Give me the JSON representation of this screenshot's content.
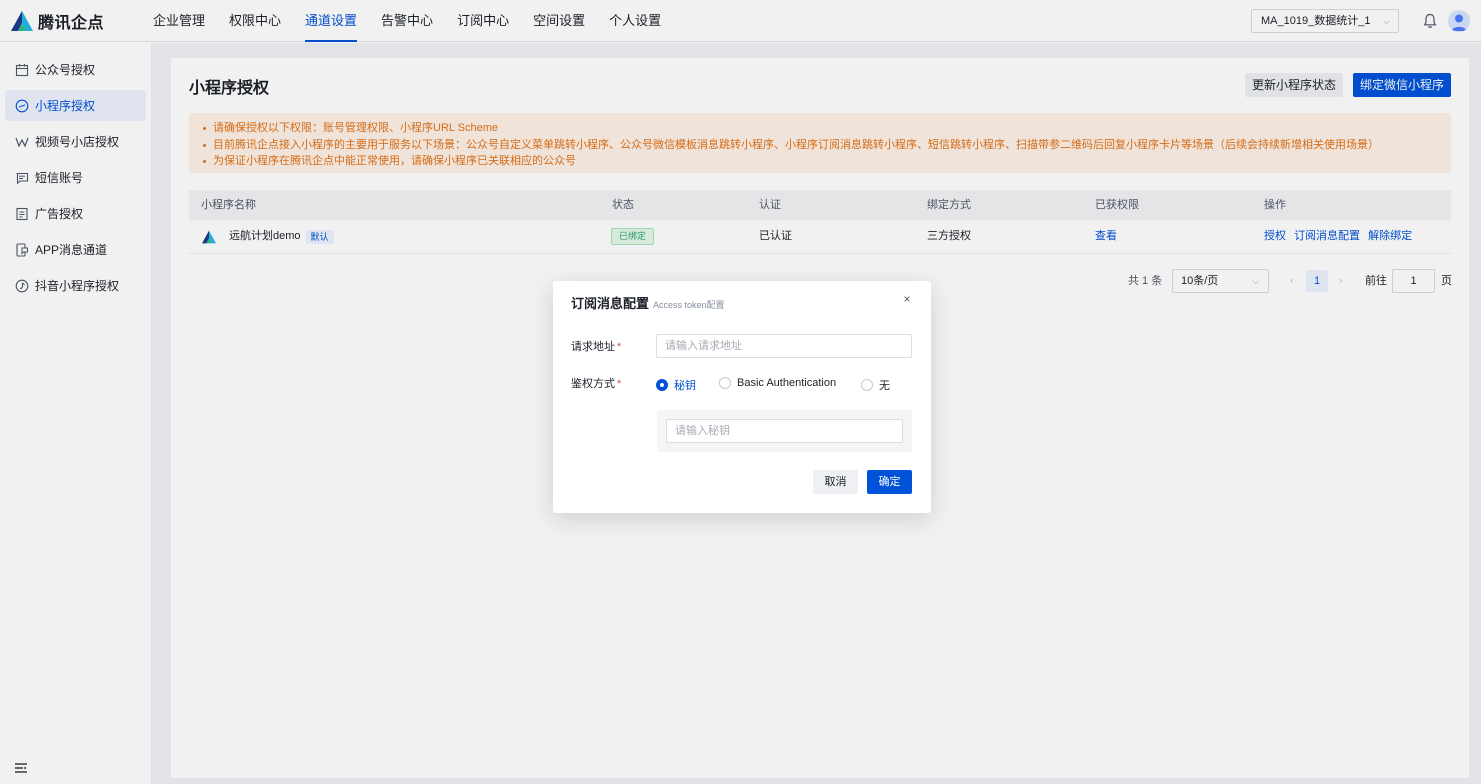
{
  "brand": {
    "name": "腾讯企点",
    "colors": {
      "primary": "#0052d9",
      "logo_dark": "#1d3a8a",
      "logo_light": "#27b9e6",
      "logo_green": "#2bbf8a"
    }
  },
  "nav": {
    "items": [
      {
        "label": "企业管理",
        "active": false
      },
      {
        "label": "权限中心",
        "active": false
      },
      {
        "label": "通道设置",
        "active": true
      },
      {
        "label": "告警中心",
        "active": false
      },
      {
        "label": "订阅中心",
        "active": false
      },
      {
        "label": "空间设置",
        "active": false
      },
      {
        "label": "个人设置",
        "active": false
      }
    ],
    "project_select": "MA_1019_数据统计_1",
    "icons": {
      "dropdown": "chevron-down-icon",
      "bell": "bell-icon",
      "avatar": "user-avatar-icon"
    }
  },
  "sidebar": {
    "items": [
      {
        "label": "公众号授权",
        "icon": "calendar-icon"
      },
      {
        "label": "小程序授权",
        "icon": "mini-program-icon",
        "active": true
      },
      {
        "label": "视频号小店授权",
        "icon": "video-channel-icon"
      },
      {
        "label": "短信账号",
        "icon": "sms-icon"
      },
      {
        "label": "广告授权",
        "icon": "document-icon"
      },
      {
        "label": "APP消息通道",
        "icon": "app-message-icon"
      },
      {
        "label": "抖音小程序授权",
        "icon": "douyin-icon"
      }
    ],
    "collapse_icon": "menu-fold-icon"
  },
  "page": {
    "title": "小程序授权",
    "btn_refresh": "更新小程序状态",
    "btn_bind": "绑定微信小程序",
    "notice": [
      "请确保授权以下权限：账号管理权限、小程序URL Scheme",
      "目前腾讯企点接入小程序的主要用于服务以下场景：公众号自定义菜单跳转小程序、公众号微信模板消息跳转小程序、小程序订阅消息跳转小程序、短信跳转小程序、扫描带参二维码后回复小程序卡片等场景（后续会持续新增相关使用场景）",
      "为保证小程序在腾讯企点中能正常使用，请确保小程序已关联相应的公众号"
    ]
  },
  "table": {
    "columns": [
      "小程序名称",
      "状态",
      "认证",
      "绑定方式",
      "已获权限",
      "操作"
    ],
    "rows": [
      {
        "name": "远航计划demo",
        "default_tag": "默认",
        "status": "已绑定",
        "auth": "已认证",
        "bind_method": "三方授权",
        "permission": "查看",
        "actions": [
          "授权",
          "订阅消息配置",
          "解除绑定"
        ]
      }
    ]
  },
  "pagination": {
    "total": "共 1 条",
    "page_size": "10条/页",
    "prev": "‹",
    "current": "1",
    "next": "›",
    "goto_prefix": "前往",
    "goto_value": "1",
    "goto_suffix": "页"
  },
  "modal": {
    "title": "订阅消息配置",
    "subtitle": "Access token配置",
    "close": "×",
    "url_label": "请求地址",
    "url_placeholder": "请输入请求地址",
    "auth_label": "鉴权方式",
    "required_mark": "*",
    "auth_options": [
      {
        "label": "秘钥",
        "checked": true
      },
      {
        "label": "Basic Authentication",
        "checked": false
      },
      {
        "label": "无",
        "checked": false
      }
    ],
    "secret_placeholder": "请输入秘钥",
    "cancel": "取消",
    "confirm": "确定"
  }
}
